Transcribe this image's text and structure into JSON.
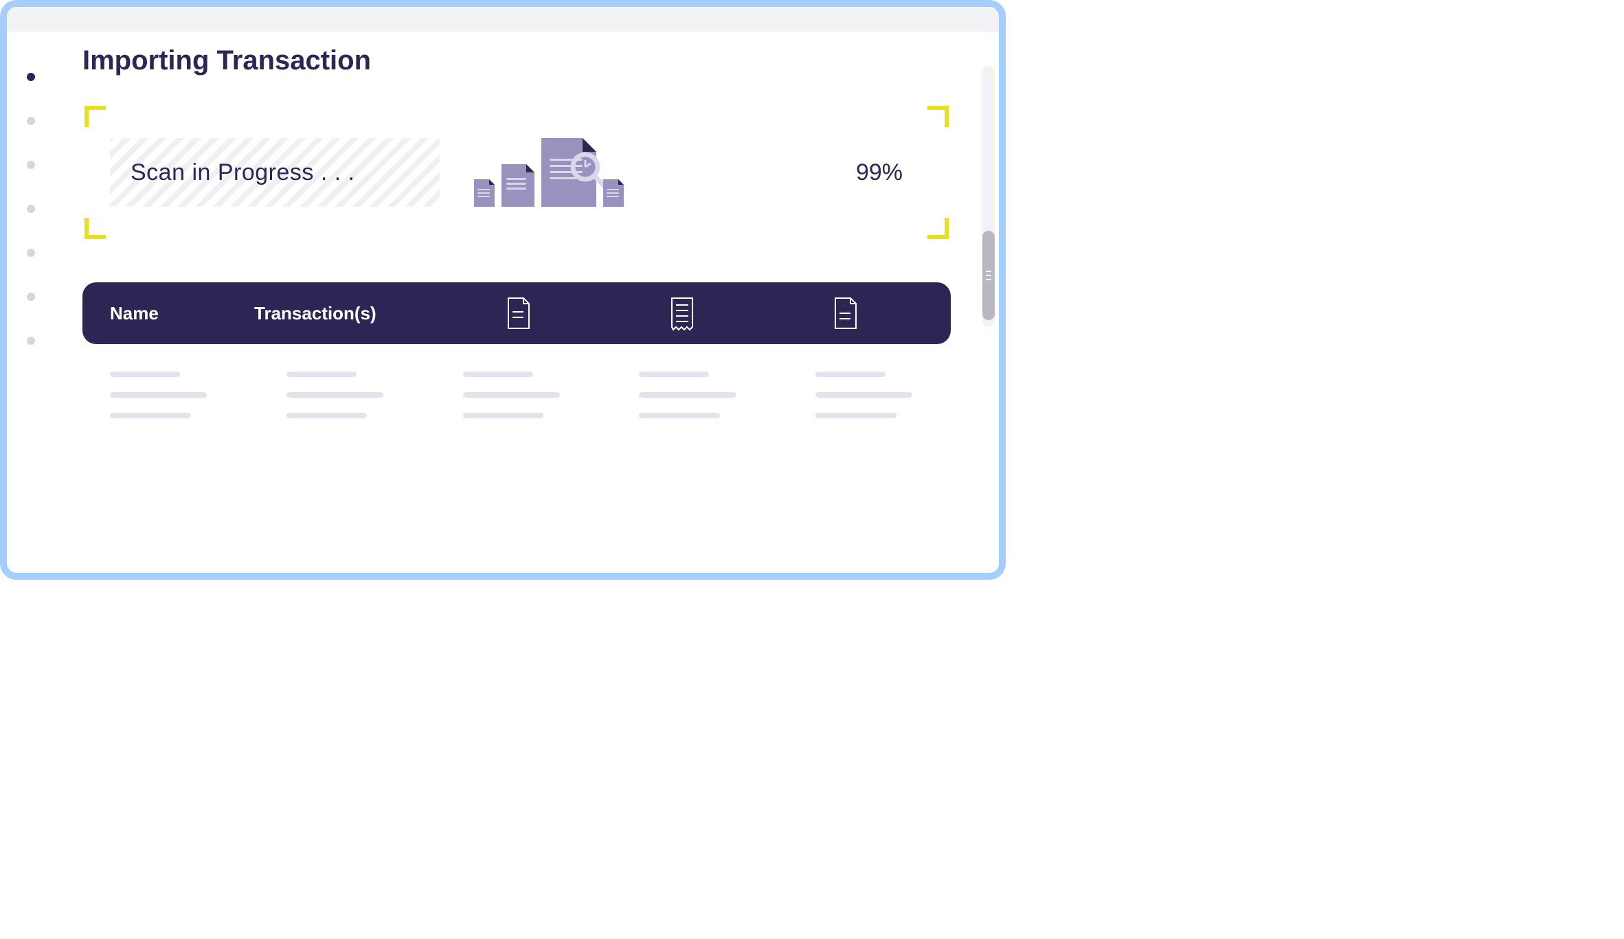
{
  "page": {
    "title": "Importing Transaction"
  },
  "scan": {
    "status_text": "Scan in Progress  .  .  .",
    "percent": "99%"
  },
  "table": {
    "headers": {
      "name": "Name",
      "transactions": "Transaction(s)"
    }
  },
  "sidebar": {
    "active_index": 0,
    "items_count": 7
  },
  "colors": {
    "frame": "#a5ceff",
    "primary": "#2c2654",
    "accent": "#e6e01f",
    "muted": "#9793be"
  }
}
